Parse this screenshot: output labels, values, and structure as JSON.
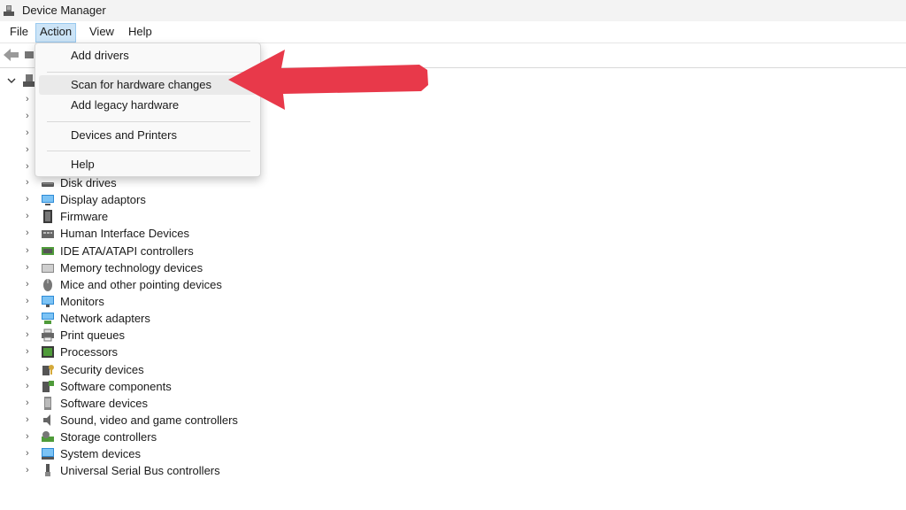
{
  "window": {
    "title": "Device Manager"
  },
  "menubar": {
    "items": [
      "File",
      "Action",
      "View",
      "Help"
    ]
  },
  "action_menu": {
    "items": [
      "Add drivers",
      "Scan for hardware changes",
      "Add legacy hardware",
      "Devices and Printers",
      "Help"
    ],
    "highlighted": "Scan for hardware changes"
  },
  "tree": {
    "categories": [
      "Disk drives",
      "Display adaptors",
      "Firmware",
      "Human Interface Devices",
      "IDE ATA/ATAPI controllers",
      "Memory technology devices",
      "Mice and other pointing devices",
      "Monitors",
      "Network adapters",
      "Print queues",
      "Processors",
      "Security devices",
      "Software components",
      "Software devices",
      "Sound, video and game controllers",
      "Storage controllers",
      "System devices",
      "Universal Serial Bus controllers"
    ]
  },
  "icons": {
    "app": "device-manager-icon",
    "back": "back-arrow-icon",
    "forward": "forward-arrow-icon",
    "expand": "chevron-right-icon",
    "collapse": "chevron-down-icon",
    "annotation": "red-arrow-annotation"
  },
  "colors": {
    "menu_active": "#cce4f7",
    "menu_hover": "#eaeaea",
    "arrow": "#e8394a"
  }
}
